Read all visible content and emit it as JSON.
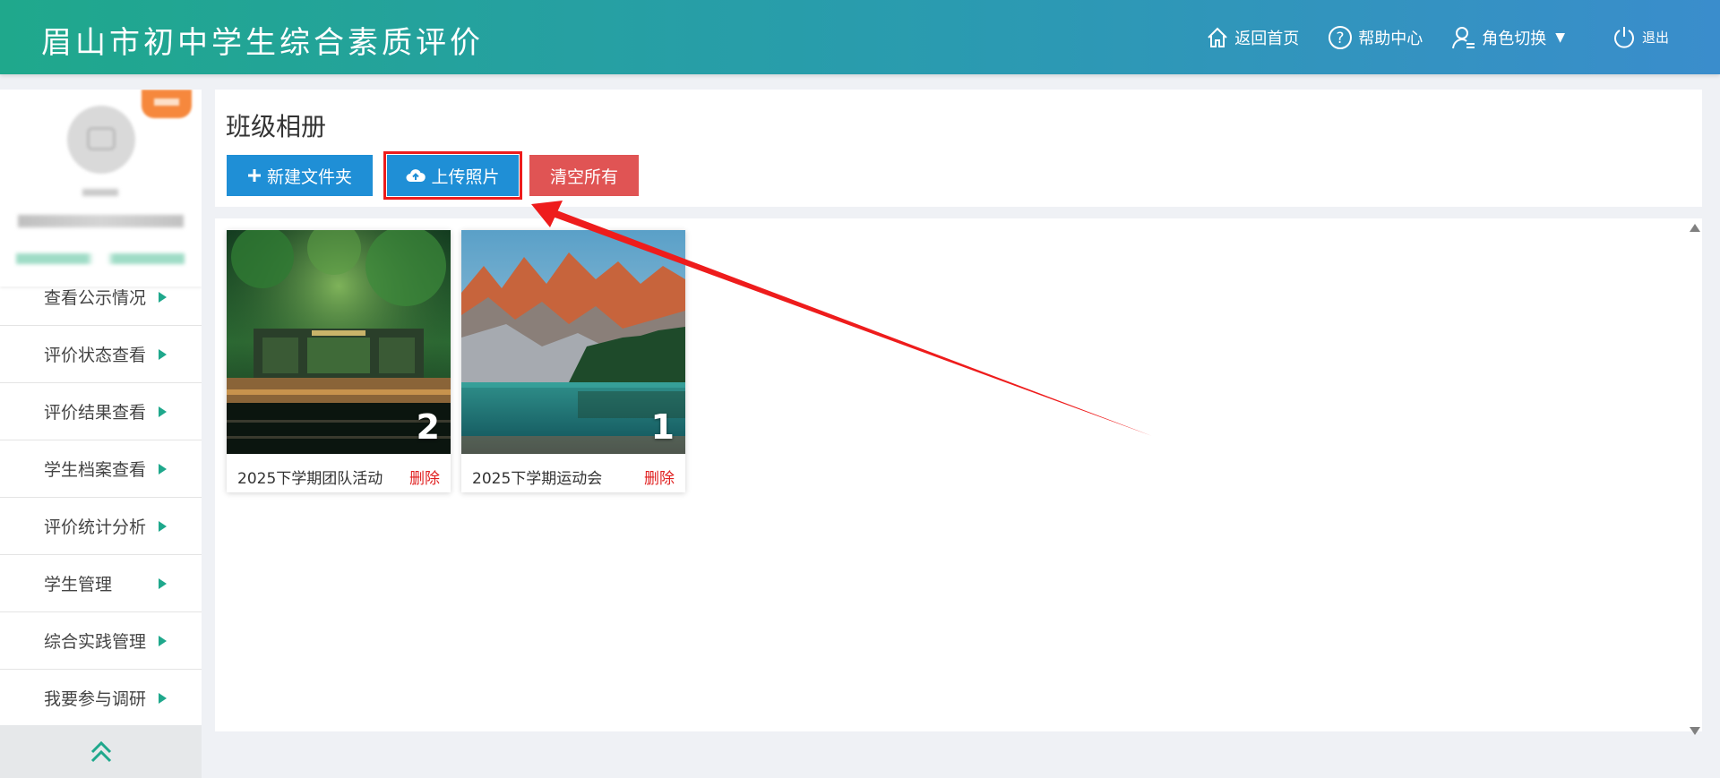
{
  "header": {
    "title": "眉山市初中学生综合素质评价",
    "nav": {
      "home": "返回首页",
      "help": "帮助中心",
      "role": "角色切换",
      "logout": "退出"
    }
  },
  "sidebar": {
    "menu": [
      {
        "label": "查看公示情况"
      },
      {
        "label": "评价状态查看"
      },
      {
        "label": "评价结果查看"
      },
      {
        "label": "学生档案查看"
      },
      {
        "label": "评价统计分析"
      },
      {
        "label": "学生管理"
      },
      {
        "label": "综合实践管理"
      },
      {
        "label": "我要参与调研"
      }
    ]
  },
  "main": {
    "title": "班级相册",
    "toolbar": {
      "new_folder": "新建文件夹",
      "upload": "上传照片",
      "clear_all": "清空所有"
    },
    "albums": [
      {
        "name": "2025下学期团队活动",
        "count": "2",
        "delete": "删除",
        "image": "forest-station-photo"
      },
      {
        "name": "2025下学期运动会",
        "count": "1",
        "delete": "删除",
        "image": "mountain-lake-photo"
      }
    ]
  },
  "colors": {
    "header_start": "#1fa88c",
    "header_end": "#3a8dcc",
    "primary_button": "#1f8fd6",
    "danger_button": "#e05454",
    "menu_arrow": "#1fa88c",
    "annotation": "#ee1c1c"
  }
}
